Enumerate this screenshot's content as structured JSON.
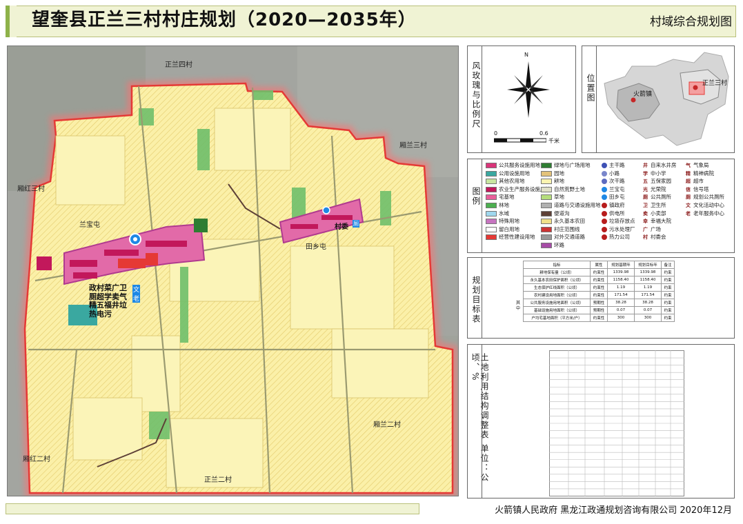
{
  "header": {
    "title": "望奎县正兰三村村庄规划（2020—2035年）",
    "subtitle": "村域综合规划图"
  },
  "map": {
    "neighbors": {
      "north": "正兰四村",
      "northeast": "厢兰三村",
      "west": "厢红三村",
      "southwest": "厢红二村",
      "southeast": "厢兰二村",
      "south": "正兰二村"
    },
    "settlements": {
      "west": "兰宝屯",
      "east": "田乡屯"
    },
    "west_facility_lines": [
      "政村菜广卫",
      "厕超学卖气",
      "精五福井垃",
      "热电污"
    ],
    "west_facility_tags": [
      "文",
      "老"
    ],
    "east_facility_label": "村委",
    "east_facility_tag": "厕"
  },
  "compass_panel": {
    "side_title": "风玫瑰与比例尺",
    "north": "N",
    "scale_start": "0",
    "scale_end": "0.6",
    "unit": "千米"
  },
  "location_panel": {
    "side_title": "位置图",
    "town": "火箭镇",
    "village": "正兰三村"
  },
  "legend": {
    "side_title": "图例",
    "col1": [
      {
        "label": "公共服务设施用地",
        "color": "#d9357a"
      },
      {
        "label": "公用设施用地",
        "color": "#3aa8a0"
      },
      {
        "label": "其他农用地",
        "color": "#c8e6a0"
      },
      {
        "label": "农业生产服务设施用地",
        "color": "#c2185b"
      },
      {
        "label": "宅基地",
        "color": "#e85f9a"
      },
      {
        "label": "林地",
        "color": "#4caf50"
      },
      {
        "label": "水域",
        "color": "#9fd7ee"
      },
      {
        "label": "特殊用地",
        "color": "#c674c0"
      },
      {
        "label": "留白用地",
        "color": "#ffffff"
      },
      {
        "label": "经营性建设用地",
        "color": "#e53935"
      }
    ],
    "col2": [
      {
        "label": "绿地与广场用地",
        "color": "#2e7d32"
      },
      {
        "label": "园地",
        "color": "#e3c27a"
      },
      {
        "label": "耕地",
        "color": "#fbf4b0"
      },
      {
        "label": "自然荒野土地",
        "color": "#e0e0c8"
      },
      {
        "label": "草地",
        "color": "#b5dd7c"
      },
      {
        "label": "道路与交通设施用地",
        "color": "#b0b0b0"
      },
      {
        "label": "便道沟",
        "color": "#5d4037"
      },
      {
        "label": "永久基本农田",
        "color": "#f0e08a"
      },
      {
        "label": "村庄范围线",
        "color": "#cc3333"
      },
      {
        "label": "对外交通道路",
        "color": "#999999"
      },
      {
        "label": "环路",
        "color": "#a64ca6"
      }
    ],
    "col3": [
      {
        "label": "主干路",
        "color": "#3f51b5"
      },
      {
        "label": "小路",
        "color": "#7986cb"
      },
      {
        "label": "次干路",
        "color": "#5c6bc0"
      },
      {
        "label": "兰宝屯",
        "color": "#1e88e5"
      },
      {
        "label": "田乡屯",
        "color": "#1e88e5"
      },
      {
        "label": "镇政府",
        "color": "#b71c1c"
      },
      {
        "label": "供电所",
        "color": "#b71c1c"
      },
      {
        "label": "垃圾存放点",
        "color": "#b71c1c"
      },
      {
        "label": "污水处理厂",
        "color": "#b71c1c"
      },
      {
        "label": "热力公司",
        "color": "#b71c1c"
      }
    ],
    "col4": [
      {
        "label": "自来水井房",
        "glyph": "井"
      },
      {
        "label": "中小学",
        "glyph": "学"
      },
      {
        "label": "五保家园",
        "glyph": "五"
      },
      {
        "label": "光荣院",
        "glyph": "光"
      },
      {
        "label": "公共厕所",
        "glyph": "厕"
      },
      {
        "label": "卫生所",
        "glyph": "卫"
      },
      {
        "label": "小卖部",
        "glyph": "卖"
      },
      {
        "label": "幸福大院",
        "glyph": "幸"
      },
      {
        "label": "广场",
        "glyph": "广"
      },
      {
        "label": "村委会",
        "glyph": "村"
      }
    ],
    "col5": [
      {
        "label": "气象局",
        "glyph": "气"
      },
      {
        "label": "精神病院",
        "glyph": "精"
      },
      {
        "label": "超市",
        "glyph": "超"
      },
      {
        "label": "信号塔",
        "glyph": "信"
      },
      {
        "label": "规划公共厕所",
        "glyph": "厕"
      },
      {
        "label": "文化活动中心",
        "glyph": "文"
      },
      {
        "label": "老年服务中心",
        "glyph": "老"
      }
    ]
  },
  "targets_panel": {
    "side_title": "规划目标表",
    "headers": [
      "指标",
      "属性",
      "规划基期年",
      "规划目标年",
      "备注"
    ],
    "rows": [
      [
        "耕地保有量（公顷）",
        "约束性",
        "1339.98",
        "1339.98",
        "约束"
      ],
      [
        "永久基本农田保护面积（公顷）",
        "约束性",
        "1158.40",
        "1158.40",
        "约束"
      ],
      [
        "生态保护红线面积（公顷）",
        "约束性",
        "1.19",
        "1.19",
        "约束"
      ],
      [
        "农村建设用地面积（公顷）",
        "约束性",
        "171.54",
        "171.54",
        "约束"
      ],
      [
        "公共服务设施用地面积（公顷）",
        "预期性",
        "38.28",
        "38.28",
        "约束"
      ],
      [
        "基础设施用地面积（公顷）",
        "预期性",
        "0.07",
        "0.07",
        "约束"
      ],
      [
        "户均宅基地面积（平方米/户）",
        "约束性",
        "300",
        "300",
        "约束"
      ]
    ],
    "sub_label": "其中"
  },
  "landuse_panel": {
    "side_title": "土地利用结构调整表 单位：公顷、%"
  },
  "footer": {
    "text": "火箭镇人民政府  黑龙江政通规划咨询有限公司  2020年12月"
  }
}
